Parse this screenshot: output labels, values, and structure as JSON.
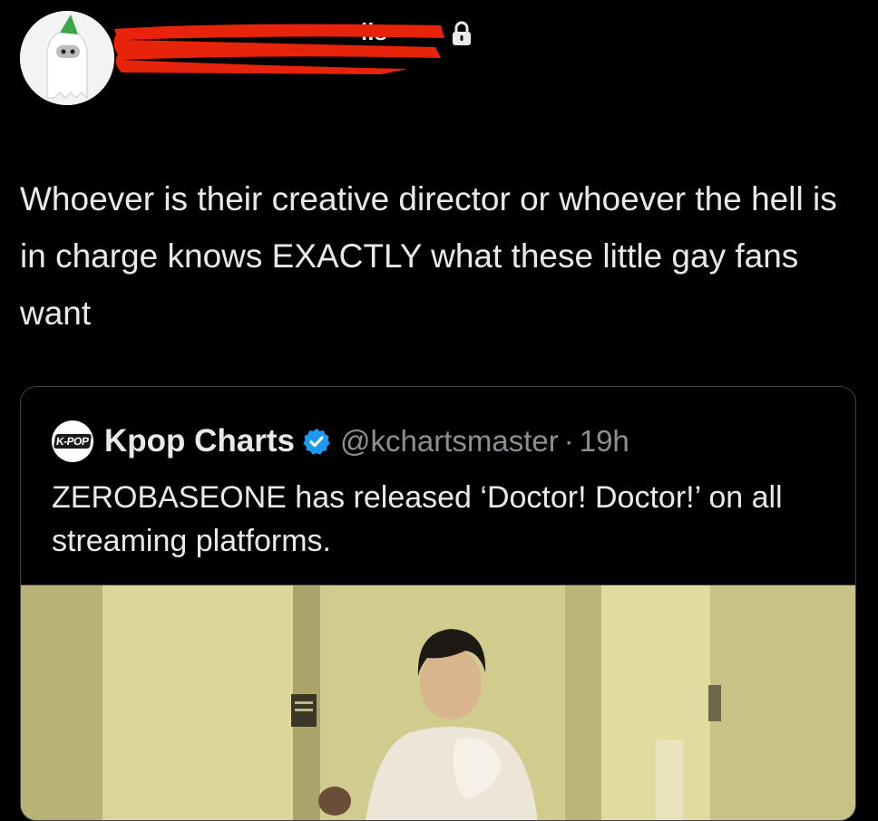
{
  "tweet": {
    "author_visible_fragment": "lls",
    "protected_icon": "lock-icon",
    "text": "Whoever is their creative director or whoever the hell is in charge knows EXACTLY what these little gay fans want"
  },
  "quote": {
    "avatar_label": "K-POP",
    "name": "Kpop Charts",
    "verified_icon": "verified-badge-icon",
    "handle": "@kchartsmaster",
    "separator": "·",
    "time": "19h",
    "text": "ZEROBASEONE has released ‘Doctor! Doctor!’ on all streaming platforms."
  },
  "colors": {
    "background": "#000000",
    "text": "#e7e9ea",
    "secondary": "#8b8f94",
    "border": "#3e4144",
    "verified": "#1d9bf0",
    "redaction": "#e8230b"
  }
}
